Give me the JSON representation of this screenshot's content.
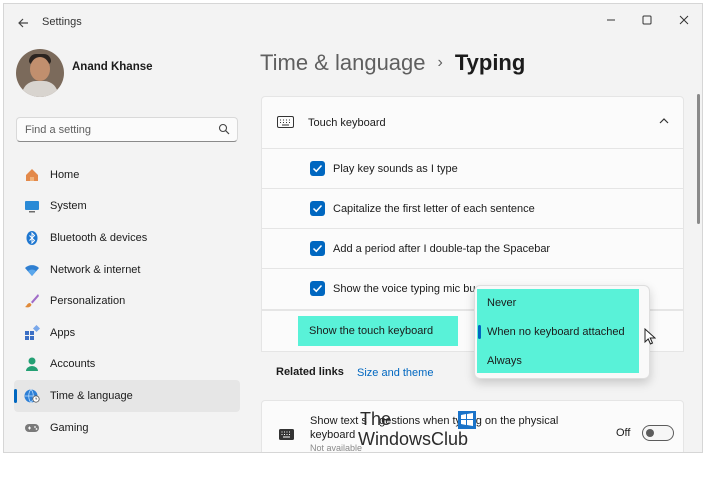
{
  "app": {
    "title": "Settings"
  },
  "window_controls": {
    "minimize": "—",
    "maximize": "☐",
    "close": "✕"
  },
  "user": {
    "name": "Anand Khanse"
  },
  "search": {
    "placeholder": "Find a setting"
  },
  "sidebar": {
    "items": [
      {
        "label": "Home",
        "icon": "home-icon"
      },
      {
        "label": "System",
        "icon": "system-icon"
      },
      {
        "label": "Bluetooth & devices",
        "icon": "bluetooth-icon"
      },
      {
        "label": "Network & internet",
        "icon": "wifi-icon"
      },
      {
        "label": "Personalization",
        "icon": "brush-icon"
      },
      {
        "label": "Apps",
        "icon": "apps-icon"
      },
      {
        "label": "Accounts",
        "icon": "accounts-icon"
      },
      {
        "label": "Time & language",
        "icon": "globe-icon",
        "selected": true
      },
      {
        "label": "Gaming",
        "icon": "gamepad-icon"
      }
    ]
  },
  "breadcrumb": {
    "parent": "Time & language",
    "separator": "›",
    "current": "Typing"
  },
  "touch_keyboard": {
    "title": "Touch keyboard",
    "options": [
      {
        "label": "Play key sounds as I type",
        "checked": true
      },
      {
        "label": "Capitalize the first letter of each sentence",
        "checked": true
      },
      {
        "label": "Add a period after I double-tap the Spacebar",
        "checked": true
      },
      {
        "label": "Show the voice typing mic bu",
        "checked": true
      }
    ],
    "show_label": "Show the touch keyboard"
  },
  "dropdown": {
    "options": [
      "Never",
      "When no keyboard attached",
      "Always"
    ],
    "selected": "When no keyboard attached"
  },
  "related": {
    "title": "Related links",
    "link": "Size and theme"
  },
  "text_suggestions": {
    "label_line1": "Show text s",
    "label_line1b": "gestions when ty",
    "label_line1c": "ing on the physical",
    "label_line2": "keyboard",
    "sub": "Not available",
    "state": "Off",
    "on": false
  },
  "watermark": {
    "line1": "The",
    "line2": "WindowsClub"
  },
  "colors": {
    "accent": "#0067c0",
    "highlight": "#59f2d8"
  }
}
